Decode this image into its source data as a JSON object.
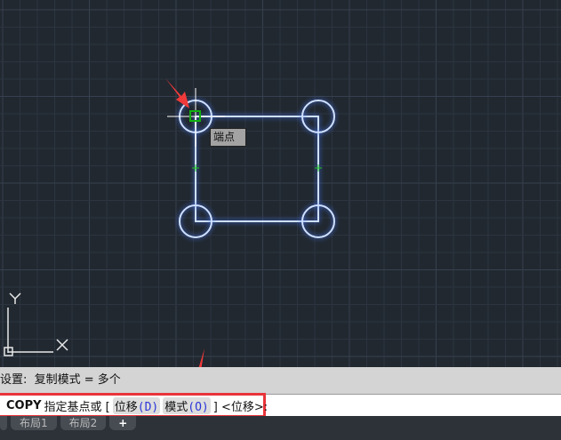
{
  "tooltip": "端点",
  "ucs": {
    "x_label": "X",
    "y_label": "Y"
  },
  "history": "设置:  复制模式 = 多个",
  "command": {
    "name": "COPY",
    "prompt": "指定基点或 [",
    "opt1": "位移",
    "opt1_key": "(D)",
    "opt2": "模式",
    "opt2_key": "(O)",
    "suffix": "] <位移>:"
  },
  "tabs": [
    "布局1",
    "布局2",
    "+"
  ]
}
